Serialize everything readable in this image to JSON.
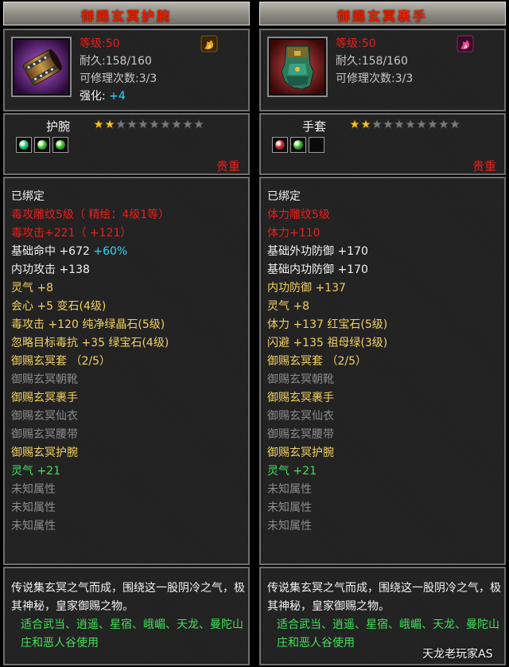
{
  "left": {
    "title": "御赐玄冥护腕",
    "level": "等级:50",
    "durability": "耐久:158/160",
    "repair": "可修理次数:3/3",
    "enhance_label": "强化:",
    "enhance_value": "+4",
    "slot": "护腕",
    "stars_filled": 2,
    "stars_total": 10,
    "gems": [
      {
        "color": "#2fd88a",
        "name": "gem-green-blue"
      },
      {
        "color": "#4cd63a",
        "name": "gem-green"
      },
      {
        "color": "#3cce2a",
        "name": "gem-green"
      }
    ],
    "quality": "贵重",
    "stats": [
      {
        "text": "已绑定",
        "color": "white"
      },
      {
        "text": "毒攻雕纹5级（ 精绘：4级1等）",
        "color": "red"
      },
      {
        "text": "毒攻击+221（ +121）",
        "color": "red"
      },
      {
        "text": "基础命中 +672 ",
        "color": "white",
        "extra": "+60%",
        "extra_color": "cyan"
      },
      {
        "text": "内功攻击 +138",
        "color": "white"
      },
      {
        "text": "灵气 +8",
        "color": "yellow"
      },
      {
        "text": "会心 +5 变石(4级)",
        "color": "yellow"
      },
      {
        "text": "毒攻击 +120 纯净绿晶石(5级)",
        "color": "yellow"
      },
      {
        "text": "忽略目标毒抗 +35 绿宝石(4级)",
        "color": "yellow"
      },
      {
        "text": "御赐玄冥套 （2/5）",
        "color": "yellow"
      },
      {
        "text": "御赐玄冥朝靴",
        "color": "dim"
      },
      {
        "text": "御赐玄冥裹手",
        "color": "yellow"
      },
      {
        "text": "御赐玄冥仙衣",
        "color": "dim"
      },
      {
        "text": "御赐玄冥腰带",
        "color": "dim"
      },
      {
        "text": "御赐玄冥护腕",
        "color": "yellow"
      },
      {
        "text": "灵气 +21",
        "color": "green"
      },
      {
        "text": "未知属性",
        "color": "dim"
      },
      {
        "text": "未知属性",
        "color": "dim"
      },
      {
        "text": "未知属性",
        "color": "dim"
      }
    ],
    "desc": "传说集玄冥之气而成，围绕这一股阴冷之气，极其神秘，皇家御赐之物。",
    "usable": "适合武当、逍遥、星宿、峨嵋、天龙、曼陀山庄和恶人谷使用"
  },
  "right": {
    "title": "御赐玄冥裹手",
    "level": "等级:50",
    "durability": "耐久:158/160",
    "repair": "可修理次数:3/3",
    "slot": "手套",
    "stars_filled": 2,
    "stars_total": 10,
    "gems": [
      {
        "color": "#e02a38",
        "name": "gem-red"
      },
      {
        "color": "#3fc42e",
        "name": "gem-green"
      },
      {
        "color": "",
        "name": "gem-empty"
      }
    ],
    "quality": "贵重",
    "stats": [
      {
        "text": "已绑定",
        "color": "white"
      },
      {
        "text": "体力雕纹5级",
        "color": "red"
      },
      {
        "text": "体力+110",
        "color": "red"
      },
      {
        "text": "基础外功防御 +170",
        "color": "white"
      },
      {
        "text": "基础内功防御 +170",
        "color": "white"
      },
      {
        "text": "内功防御 +137",
        "color": "yellow"
      },
      {
        "text": "灵气 +8",
        "color": "yellow"
      },
      {
        "text": "体力 +137 红宝石(5级)",
        "color": "yellow"
      },
      {
        "text": "闪避 +135 祖母绿(3级)",
        "color": "yellow"
      },
      {
        "text": "御赐玄冥套 （2/5）",
        "color": "yellow"
      },
      {
        "text": "御赐玄冥朝靴",
        "color": "dim"
      },
      {
        "text": "御赐玄冥裹手",
        "color": "yellow"
      },
      {
        "text": "御赐玄冥仙衣",
        "color": "dim"
      },
      {
        "text": "御赐玄冥腰带",
        "color": "dim"
      },
      {
        "text": "御赐玄冥护腕",
        "color": "yellow"
      },
      {
        "text": "灵气 +21",
        "color": "green"
      },
      {
        "text": "未知属性",
        "color": "dim"
      },
      {
        "text": "未知属性",
        "color": "dim"
      },
      {
        "text": "未知属性",
        "color": "dim"
      }
    ],
    "desc": "传说集玄冥之气而成，围绕这一股阴冷之气，极其神秘，皇家御赐之物。",
    "usable": "适合武当、逍遥、星宿、峨嵋、天龙、曼陀山庄和恶人谷使用"
  },
  "watermark": "天龙老玩家AS"
}
